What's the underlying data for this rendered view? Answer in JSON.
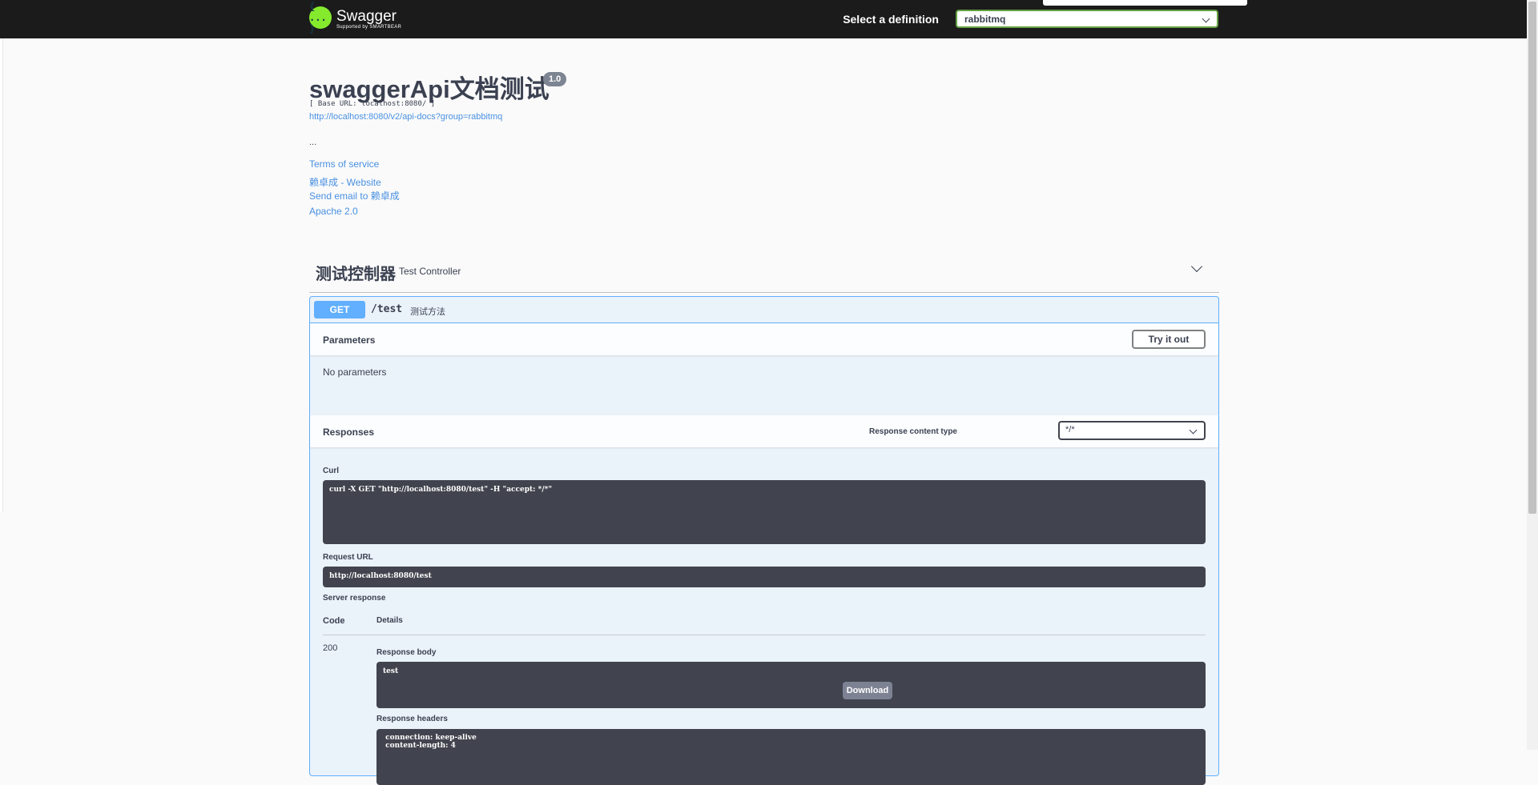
{
  "topbar": {
    "logo_icon": "{ ... }",
    "logo_name": "Swagger",
    "logo_sub": "Supported by SMARTBEAR",
    "definition_label": "Select a definition",
    "definition_value": "rabbitmq"
  },
  "info": {
    "title": "swaggerApi文档测试",
    "version": "1.0",
    "base_url": "[ Base URL: localhost:8080/ ]",
    "api_docs_url": "http://localhost:8080/v2/api-docs?group=rabbitmq",
    "description": "...",
    "terms": "Terms of service",
    "website": "赖卓成 - Website",
    "email": "Send email to 赖卓成",
    "license": "Apache 2.0"
  },
  "tag": {
    "name": "测试控制器",
    "description": "Test Controller"
  },
  "operation": {
    "method": "GET",
    "path": "/test",
    "summary": "测试方法",
    "parameters_title": "Parameters",
    "try_it_out": "Try it out",
    "no_parameters": "No parameters",
    "responses_title": "Responses",
    "response_content_type_label": "Response content type",
    "response_content_type_value": "*/*",
    "curl_label": "Curl",
    "curl": "curl -X GET \"http://localhost:8080/test\" -H \"accept: */*\"",
    "request_url_label": "Request URL",
    "request_url": "http://localhost:8080/test",
    "server_response_label": "Server response",
    "code_header": "Code",
    "details_header": "Details",
    "code": "200",
    "response_body_label": "Response body",
    "response_body": "test",
    "download": "Download",
    "response_headers_label": "Response headers",
    "response_headers": [
      " connection: keep-alive",
      " content-length: 4"
    ]
  },
  "colors": {
    "topbar": "#1b1b1b",
    "get": "#61affe",
    "link": "#4990e2",
    "code_bg": "#41444e",
    "select_border": "#62a03f"
  }
}
